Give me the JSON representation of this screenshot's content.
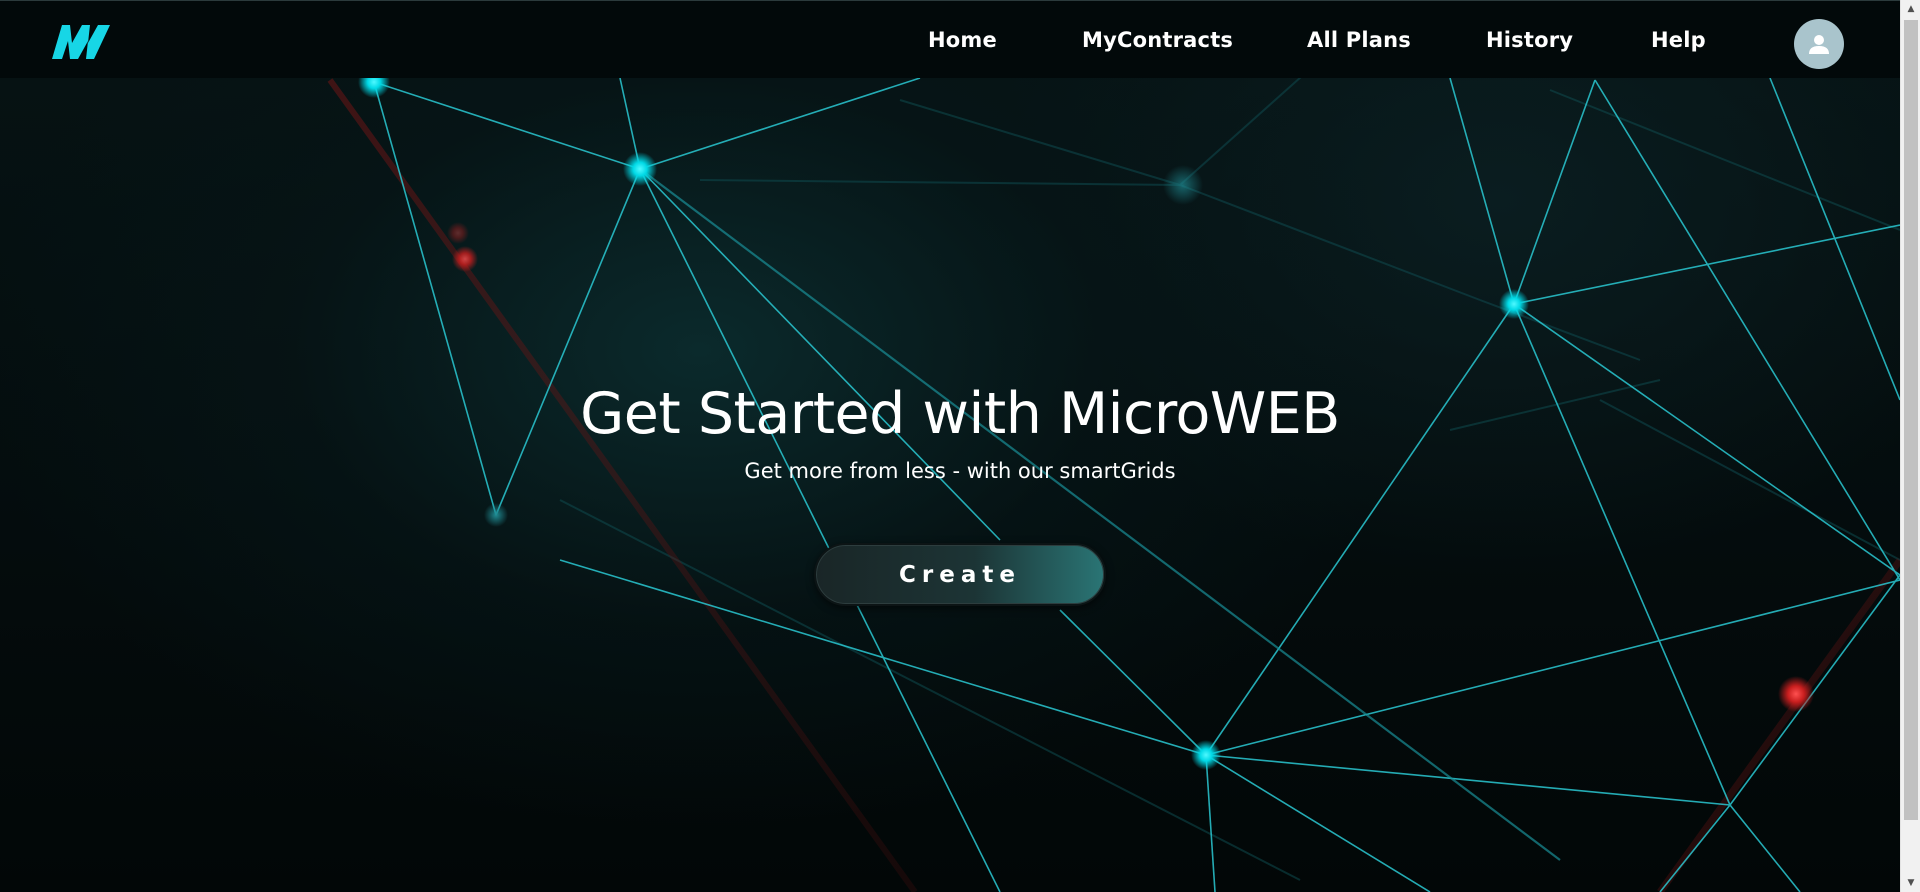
{
  "header": {
    "logo_text": "MW",
    "nav": [
      {
        "label": "Home"
      },
      {
        "label": "MyContracts"
      },
      {
        "label": "All Plans"
      },
      {
        "label": "History"
      },
      {
        "label": "Help"
      }
    ],
    "avatar_icon": "user-icon"
  },
  "hero": {
    "title": "Get Started with MicroWEB",
    "subtitle": "Get more from less - with our smartGrids",
    "cta_label": "Create"
  },
  "colors": {
    "accent": "#00e5f0",
    "node_red": "#d92b2b",
    "header_bg": "#02090a"
  },
  "scrollbar": {
    "up_icon": "arrow-up-icon",
    "down_icon": "arrow-down-icon"
  }
}
